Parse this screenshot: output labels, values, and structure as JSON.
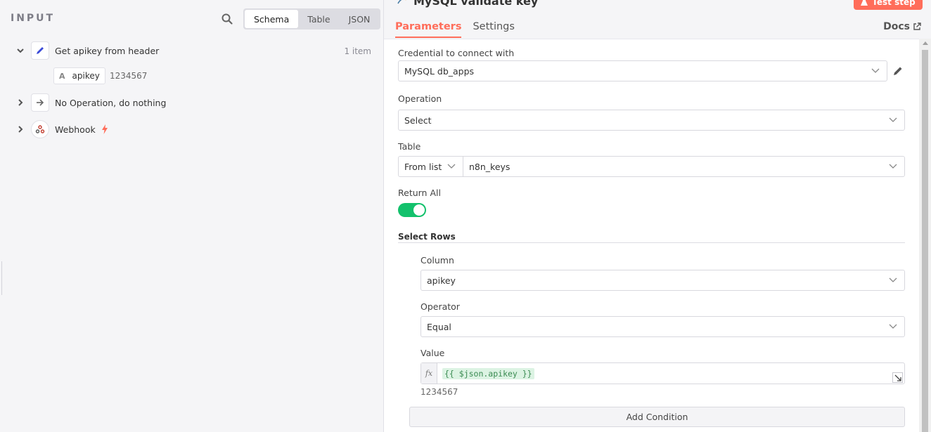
{
  "input": {
    "title": "INPUT",
    "view_tabs": [
      "Schema",
      "Table",
      "JSON"
    ],
    "active_view": "Schema",
    "nodes": [
      {
        "label": "Get apikey from header",
        "count": "1 item",
        "expanded": true,
        "icon": "pencil-icon"
      },
      {
        "label": "No Operation, do nothing",
        "expanded": false,
        "icon": "arrow-right-icon"
      },
      {
        "label": "Webhook",
        "expanded": false,
        "icon": "webhook-icon"
      }
    ],
    "field": {
      "type": "A",
      "name": "apikey",
      "value": "1234567"
    }
  },
  "node": {
    "title": "MySQL validate key",
    "test_button": "Test step"
  },
  "tabs": [
    {
      "label": "Parameters",
      "active": true
    },
    {
      "label": "Settings",
      "active": false
    }
  ],
  "docs_label": "Docs",
  "params": {
    "credential_label": "Credential to connect with",
    "credential_value": "MySQL db_apps",
    "operation_label": "Operation",
    "operation_value": "Select",
    "table_label": "Table",
    "table_mode": "From list",
    "table_value": "n8n_keys",
    "return_all_label": "Return All",
    "return_all": true,
    "select_rows_label": "Select Rows",
    "column_label": "Column",
    "column_value": "apikey",
    "operator_label": "Operator",
    "operator_value": "Equal",
    "value_label": "Value",
    "value_expr": "{{ $json.apikey }}",
    "value_result": "1234567",
    "add_condition": "Add Condition"
  },
  "colors": {
    "accent": "#ff6d5a",
    "toggle_on": "#13c16c",
    "expression_text": "#3a8b52"
  }
}
